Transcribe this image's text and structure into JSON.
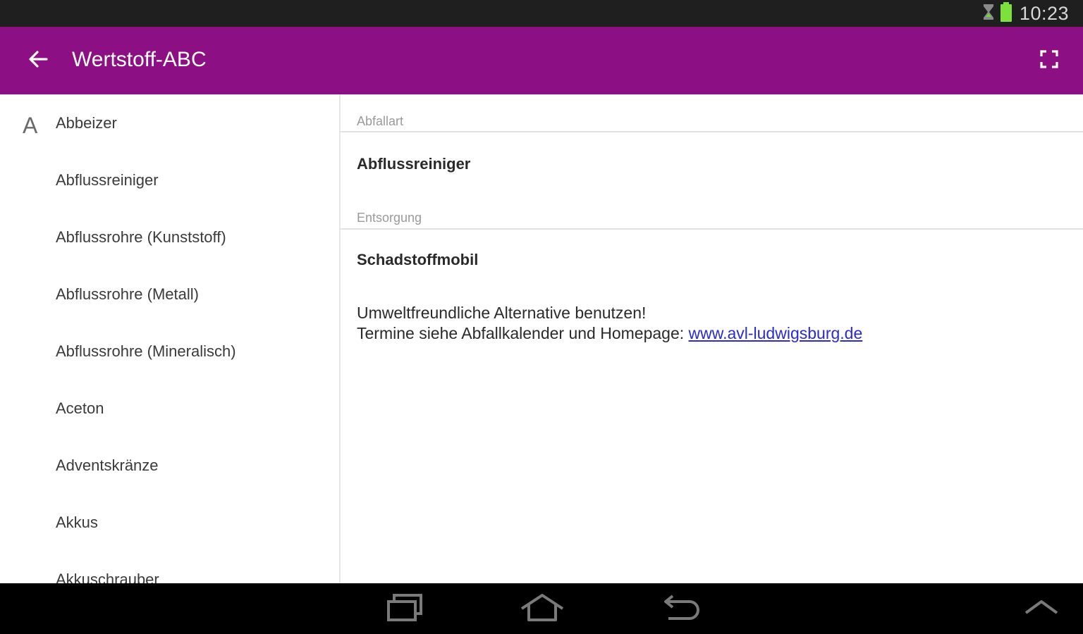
{
  "status_bar": {
    "time": "10:23",
    "icons": [
      "hourglass-icon",
      "battery-icon"
    ]
  },
  "app_bar": {
    "title": "Wertstoff-ABC",
    "back_icon": "arrow-left-icon",
    "fullscreen_icon": "fullscreen-icon",
    "background_color": "#8c0f84"
  },
  "list": {
    "section_letter": "A",
    "items": [
      {
        "label": "Abbeizer"
      },
      {
        "label": "Abflussreiniger"
      },
      {
        "label": "Abflussrohre (Kunststoff)"
      },
      {
        "label": "Abflussrohre (Metall)"
      },
      {
        "label": "Abflussrohre (Mineralisch)"
      },
      {
        "label": "Aceton"
      },
      {
        "label": "Adventskränze"
      },
      {
        "label": "Akkus"
      },
      {
        "label": "Akkuschrauber"
      }
    ]
  },
  "detail": {
    "abfallart_header": "Abfallart",
    "abfallart_value": "Abflussreiniger",
    "entsorgung_header": "Entsorgung",
    "entsorgung_value": "Schadstoffmobil",
    "note_line1": "Umweltfreundliche Alternative benutzen!",
    "note_line2_prefix": "Termine siehe Abfallkalender und Homepage: ",
    "note_link": "www.avl-ludwigsburg.de"
  },
  "nav_bar": {
    "icons": [
      "recent-apps-icon",
      "home-icon",
      "back-icon",
      "chevron-up-icon"
    ]
  }
}
